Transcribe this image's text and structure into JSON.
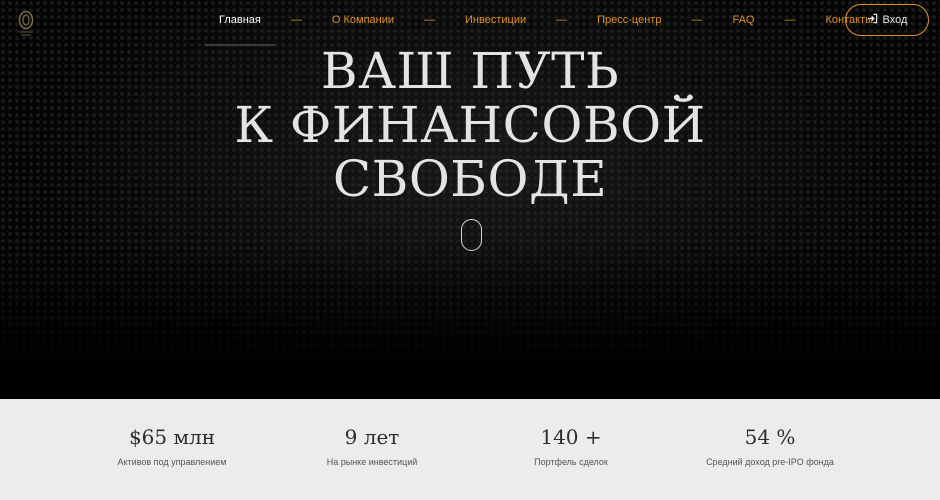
{
  "nav": {
    "items": [
      {
        "label": "Главная",
        "active": true
      },
      {
        "label": "О Компании"
      },
      {
        "label": "Инвестиции"
      },
      {
        "label": "Пресс-центр"
      },
      {
        "label": "FAQ"
      },
      {
        "label": "Контакты"
      }
    ],
    "separator": "—"
  },
  "login": {
    "label": "Вход",
    "icon": "login-icon"
  },
  "hero": {
    "line1": "ВАШ ПУТЬ",
    "line2": "К ФИНАНСОВОЙ",
    "line3": "СВОБОДЕ"
  },
  "stats": [
    {
      "value": "$65 млн",
      "label": "Активов под управлением"
    },
    {
      "value": "9 лет",
      "label": "На рынке инвестиций"
    },
    {
      "value": "140 +",
      "label": "Портфель сделок"
    },
    {
      "value": "54 %",
      "label": "Средний доход pre-IPO фонда"
    }
  ],
  "colors": {
    "accent": "#e0912a",
    "background": "#000000",
    "stats_background": "#ececec"
  }
}
